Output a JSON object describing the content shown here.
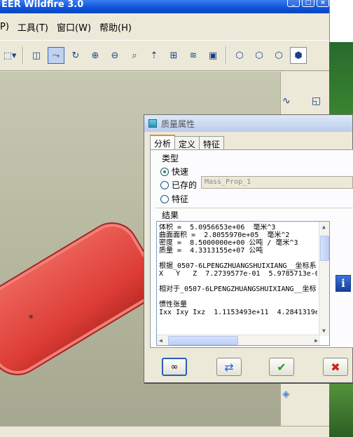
{
  "window": {
    "title": "EER Wildfire 3.0"
  },
  "menu": [
    {
      "label": "P)"
    },
    {
      "label": "工具(T)"
    },
    {
      "label": "窗口(W)"
    },
    {
      "label": "帮助(H)"
    }
  ],
  "toolbar_icons": [
    "dotted-select-icon",
    "spin-center-icon",
    "orient-icon",
    "zoom-in-icon",
    "zoom-out-icon",
    "refit-icon",
    "view-manager-icon",
    "layers-icon",
    "layers-stack-icon",
    "saved-view-icon",
    "wireframe-icon",
    "hidden-line-icon",
    "no-hidden-icon",
    "shaded-icon"
  ],
  "dialog": {
    "title": "质量属性",
    "tabs": [
      "分析",
      "定义",
      "特征"
    ],
    "active_tab": "分析",
    "type_group": "类型",
    "options": [
      {
        "label": "快速",
        "checked": true
      },
      {
        "label": "已存的",
        "checked": false
      },
      {
        "label": "特征",
        "checked": false
      }
    ],
    "mass_prop_field": "Mass_Prop_1",
    "results_group": "结果",
    "results_lines": [
      "体积 =  5.0956653e+06  毫米^3",
      "曲面面积 =  2.8055970e+05  毫米^2",
      "密度 =  8.5000000e+00 公吨 / 毫米^3",
      "质量 =  4.3313155e+07 公吨",
      "",
      "根据_0507-6LPENGZHUANGSHUIXIANG__坐标系",
      "X   Y   Z  7.2739577e-01  5.9785713e-0",
      "",
      "相对于_0507-6LPENGZHUANGSHUIXIANG__坐标",
      "",
      "惯性张量",
      "Ixx Ixy Ixz  1.1153493e+11  4.2841319e"
    ],
    "buttons": {
      "glasses": "glasses-icon",
      "repeat": "recompute-icon",
      "ok": "checkmark-icon",
      "cancel": "cancel-icon"
    }
  }
}
